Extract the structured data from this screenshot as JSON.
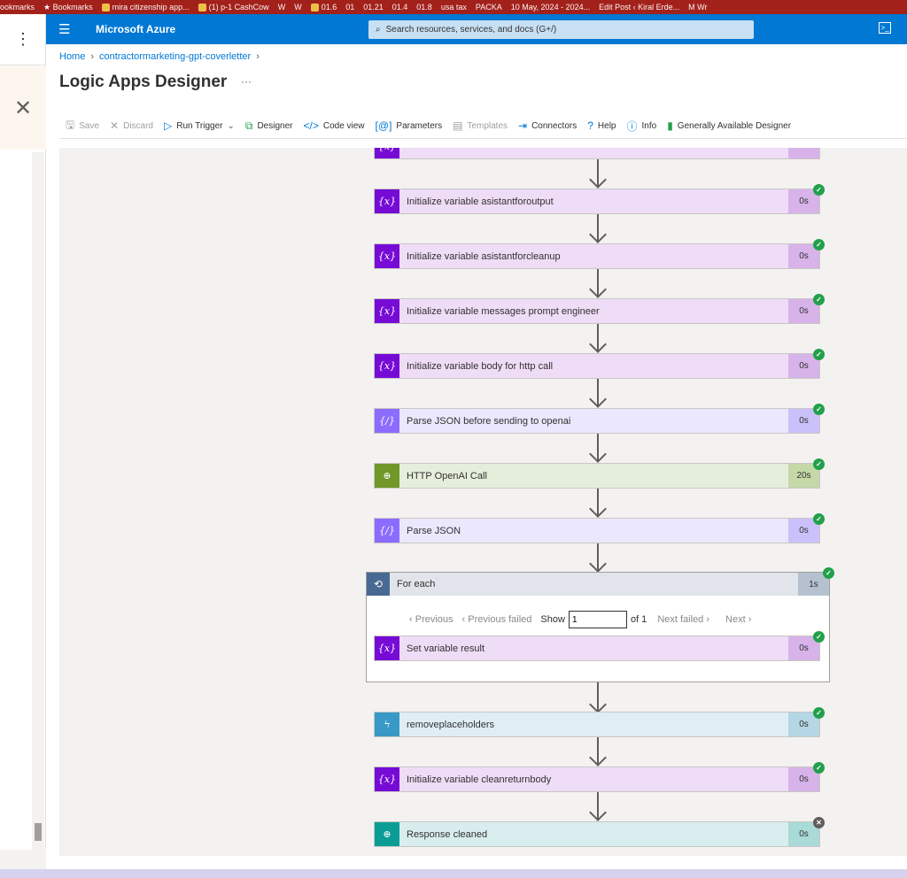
{
  "bookmarks": [
    "ookmarks",
    "★ Bookmarks",
    "mira citizenship app...",
    "(1) p-1 CashCow",
    "W",
    "W",
    "01.6",
    "01",
    "01.21",
    "01.4",
    "01.8",
    "usa tax",
    "PACKA",
    "10 May, 2024 - 2024...",
    "Edit Post ‹ Kiral Erde...",
    "M Wr"
  ],
  "outer": {
    "menu_icon": "⋮",
    "close_icon": "✕"
  },
  "topbar": {
    "brand": "Microsoft Azure",
    "search_placeholder": "Search resources, services, and docs (G+/)"
  },
  "breadcrumb": {
    "home": "Home",
    "resource": "contractormarketing-gpt-coverletter"
  },
  "page": {
    "title": "Logic Apps Designer",
    "more": "···"
  },
  "toolbar": {
    "save": "Save",
    "discard": "Discard",
    "run_trigger": "Run Trigger",
    "designer": "Designer",
    "code_view": "Code view",
    "parameters": "Parameters",
    "templates": "Templates",
    "connectors": "Connectors",
    "help": "Help",
    "info": "Info",
    "ga_designer": "Generally Available Designer"
  },
  "steps": [
    {
      "title": "Initialize variable asistantforoutput",
      "duration": "0s",
      "status": "success"
    },
    {
      "title": "Initialize variable asistantforcleanup",
      "duration": "0s",
      "status": "success"
    },
    {
      "title": "Initialize variable messages prompt engineer",
      "duration": "0s",
      "status": "success"
    },
    {
      "title": "Initialize variable body for http call",
      "duration": "0s",
      "status": "success"
    },
    {
      "title": "Parse JSON before sending to openai",
      "duration": "0s",
      "status": "success"
    },
    {
      "title": "HTTP OpenAI Call",
      "duration": "20s",
      "status": "success"
    },
    {
      "title": "Parse JSON",
      "duration": "0s",
      "status": "success"
    },
    {
      "title": "removeplaceholders",
      "duration": "0s",
      "status": "success"
    },
    {
      "title": "Initialize variable cleanreturnbody",
      "duration": "0s",
      "status": "success"
    },
    {
      "title": "Response cleaned",
      "duration": "0s",
      "status": "skipped"
    }
  ],
  "foreach": {
    "title": "For each",
    "duration": "1s",
    "pager": {
      "previous": "Previous",
      "previous_failed": "Previous failed",
      "show": "Show",
      "current": "1",
      "of": "of 1",
      "next_failed": "Next failed",
      "next": "Next"
    },
    "inner_step": {
      "title": "Set variable result",
      "duration": "0s",
      "status": "success"
    }
  }
}
